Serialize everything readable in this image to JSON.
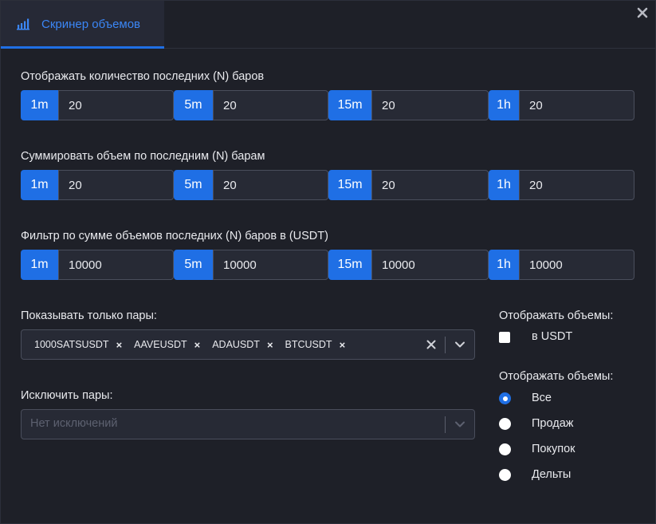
{
  "tab": {
    "label": "Скринер объемов",
    "icon": "bar-chart-icon"
  },
  "colors": {
    "accent": "#1f6fe5",
    "background": "#1e2028",
    "input_bg": "#272a35"
  },
  "sections": [
    {
      "label": "Отображать количество последних (N) баров",
      "fields": [
        {
          "tf": "1m",
          "value": "20"
        },
        {
          "tf": "5m",
          "value": "20"
        },
        {
          "tf": "15m",
          "value": "20"
        },
        {
          "tf": "1h",
          "value": "20"
        }
      ]
    },
    {
      "label": "Суммировать объем по последним (N) барам",
      "fields": [
        {
          "tf": "1m",
          "value": "20"
        },
        {
          "tf": "5m",
          "value": "20"
        },
        {
          "tf": "15m",
          "value": "20"
        },
        {
          "tf": "1h",
          "value": "20"
        }
      ]
    },
    {
      "label": "Фильтр по сумме объемов последних (N) баров в (USDT)",
      "fields": [
        {
          "tf": "1m",
          "value": "10000"
        },
        {
          "tf": "5m",
          "value": "10000"
        },
        {
          "tf": "15m",
          "value": "10000"
        },
        {
          "tf": "1h",
          "value": "10000"
        }
      ]
    }
  ],
  "only_pairs": {
    "label": "Показывать только пары:",
    "chips": [
      "1000SATSUSDT",
      "AAVEUSDT",
      "ADAUSDT",
      "BTCUSDT"
    ],
    "chip_remove": "×"
  },
  "exclude_pairs": {
    "label": "Исключить пары:",
    "placeholder": "Нет исключений"
  },
  "display_units": {
    "label": "Отображать объемы:",
    "checkbox_label": "в USDT",
    "checked": false
  },
  "display_type": {
    "label": "Отображать объемы:",
    "options": [
      "Все",
      "Продаж",
      "Покупок",
      "Дельты"
    ],
    "selected": "Все"
  }
}
